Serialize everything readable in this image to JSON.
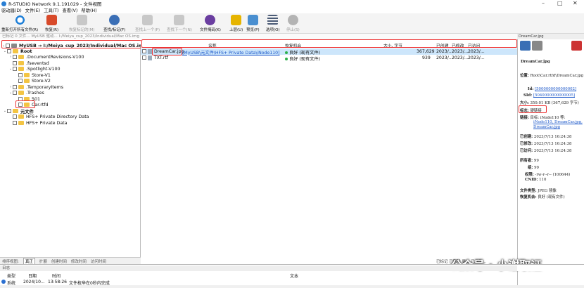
{
  "window": {
    "title": "R-STUDIO Network 9.1.191029 - 文件视图",
    "min": "–",
    "max": "□",
    "close": "✕"
  },
  "menu": [
    "驱动器(D)",
    "文件(E)",
    "工具(T)",
    "查看(V)",
    "帮助(H)"
  ],
  "toolbar": [
    {
      "label": "重新打开所有文件(R)",
      "enabled": true,
      "color": "#1e7fd8"
    },
    {
      "label": "恢复(R)",
      "enabled": true,
      "color": "#d84a2a"
    },
    {
      "label": "恢复标记的(M)",
      "enabled": false,
      "color": "#888888"
    },
    {
      "label": "查找/标记(F)",
      "enabled": true,
      "color": "#3b6fb6"
    },
    {
      "label": "查找上一个(P)",
      "enabled": false,
      "color": "#888888"
    },
    {
      "label": "查找下一个(N)",
      "enabled": false,
      "color": "#888888"
    },
    {
      "label": "文件掩码(K)",
      "enabled": true,
      "color": "#6a3ea0"
    },
    {
      "label": "上层(U)",
      "enabled": true,
      "color": "#e6b400"
    },
    {
      "label": "预览(P)",
      "enabled": true,
      "color": "#4a8fd0"
    },
    {
      "label": "选项(O)",
      "enabled": true,
      "color": "#4b5b76"
    },
    {
      "label": "停止(S)",
      "enabled": false,
      "color": "#555555"
    }
  ],
  "address": "已标记 0 文件... MyUSB 驱动... I:/Meiya_cup_2023/Individual/Mac OS.img",
  "tree": [
    {
      "label": "MyUSB → I:/Meiya_cup_2023/Individual/Mac OS.img",
      "bold": true,
      "kind": "drv",
      "expand": "⌄"
    },
    {
      "label": "Root",
      "bold": true,
      "kind": "folder",
      "expand": "⌄"
    },
    {
      "label": ".DocumentRevisions-V100",
      "kind": "folder",
      "expand": "›"
    },
    {
      "label": ".fseventsd",
      "kind": "folder",
      "expand": ""
    },
    {
      "label": ".Spotlight-V100",
      "kind": "folder",
      "expand": "⌄"
    },
    {
      "label": "Store-V1",
      "kind": "folder",
      "expand": ""
    },
    {
      "label": "Store-V2",
      "kind": "folder",
      "expand": ""
    },
    {
      "label": ".TemporaryItems",
      "kind": "folder",
      "expand": "›"
    },
    {
      "label": ".Trashes",
      "kind": "folder",
      "expand": "⌄"
    },
    {
      "label": "501",
      "kind": "folder",
      "expand": ""
    },
    {
      "label": "Car.rtfd",
      "kind": "folder",
      "expand": ""
    },
    {
      "label": "元文件",
      "bold": true,
      "kind": "folder",
      "expand": "⌄"
    },
    {
      "label": "HFS+ Private Directory Data",
      "kind": "folder",
      "expand": ""
    },
    {
      "label": "HFS+ Private Data",
      "kind": "folder",
      "expand": ""
    }
  ],
  "sort_tabs": {
    "label": "排序视图:",
    "tabs": [
      "真正",
      "扩展",
      "创建时间",
      "修改时间",
      "访问时间"
    ]
  },
  "columns": {
    "name": "名称",
    "status": "恢复机会",
    "size": "大小, 字节",
    "created": "已创建",
    "modified": "已修改",
    "accessed": "已访问"
  },
  "files": [
    {
      "name": "DreamCar.jpg",
      "link": "[MyUSB\\元文件\\HFS+ Private Data\\iNode110]",
      "status": "良好 (现有文件)",
      "size": "367,629",
      "created": "2023/...",
      "modified": "2023/...",
      "accessed": "2023/..."
    },
    {
      "name": "TXT.rtf",
      "link": "",
      "status": "良好 (现有文件)",
      "size": "939",
      "created": "2023/...",
      "modified": "2023/...",
      "accessed": "2023/..."
    }
  ],
  "right_panel": {
    "header": "DreamCar.jpg",
    "filename": "DreamCar.jpg",
    "location_label": "位置:",
    "location_value": "Root\\Car.rtfd\\DreamCar.jpg",
    "id_label": "Id:",
    "id_value": "[5000000000000002]",
    "sid_label": "SId:",
    "sid_value": "[5040000000000005]",
    "size_label": "大小:",
    "size_value": "359.01 KB (367,629 字节)",
    "tag_label": "标志:",
    "tag_value": "硬链接",
    "link_label": "链接:",
    "link_value1": "目标: iNode110 等:",
    "link_value2": "iNode110, DreamCar.jpg,",
    "link_value3": "DreamCar.jpg",
    "created_label": "已创建:",
    "created_value": "2023/7/13 16:24:38",
    "modified_label": "已修改:",
    "modified_value": "2023/7/13 16:24:38",
    "accessed_label": "已访问:",
    "accessed_value": "2023/7/13 16:24:38",
    "owner_label": "所有者:",
    "owner_value": "99",
    "group_label": "组:",
    "group_value": "99",
    "perm_label": "权限:",
    "perm_value": "-rw-r--r-- (100644)",
    "cnid_label": "CNID:",
    "cnid_value": "110",
    "type_label": "文件类型:",
    "type_value": "JPEG 镜像",
    "recover_label": "恢复机会:",
    "recover_value": "良好 (现有文件)"
  },
  "log": {
    "header": "日志",
    "columns": {
      "type": "类型",
      "date": "日期",
      "time": "时间",
      "text": "文本"
    },
    "row": {
      "type": "系统",
      "date": "2024/10...",
      "time": "13:58:26",
      "text": "文件枚举在0秒内完成"
    }
  },
  "legend": "已标记  已删除  更名  已修改...",
  "watermark": "公众号 · 小谢取证"
}
